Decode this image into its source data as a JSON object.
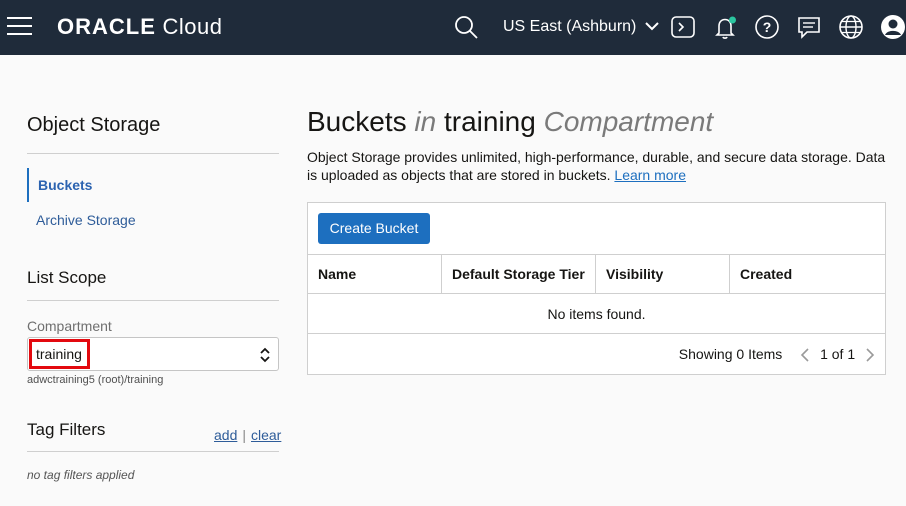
{
  "header": {
    "logo_brand": "ORACLE",
    "logo_product": "Cloud",
    "region": "US East (Ashburn)",
    "icons": [
      "menu-icon",
      "search-icon",
      "chevron-down-icon",
      "cloud-shell-icon",
      "bell-icon",
      "help-icon",
      "chat-icon",
      "globe-icon",
      "user-icon"
    ],
    "colors": {
      "bar": "#1f2b3a",
      "notification_dot": "#2bc6a0"
    }
  },
  "sidebar": {
    "title": "Object Storage",
    "nav": [
      {
        "label": "Buckets",
        "active": true
      },
      {
        "label": "Archive Storage",
        "active": false
      }
    ],
    "list_scope_title": "List Scope",
    "compartment_label": "Compartment",
    "compartment_value": "training",
    "compartment_path": "adwctraining5 (root)/training",
    "tag_filters_title": "Tag Filters",
    "tag_add": "add",
    "tag_sep": "|",
    "tag_clear": "clear",
    "no_tags": "no tag filters applied"
  },
  "main": {
    "title_part1": "Buckets",
    "title_in": "in",
    "title_compartment": "training",
    "title_suffix": "Compartment",
    "description": "Object Storage provides unlimited, high-performance, durable, and secure data storage. Data is uploaded as objects that are stored in buckets.",
    "learn_more": "Learn more",
    "create_button": "Create Bucket",
    "columns": [
      "Name",
      "Default Storage Tier",
      "Visibility",
      "Created"
    ],
    "empty_text": "No items found.",
    "showing": "Showing 0 Items",
    "page_info": "1 of 1",
    "accent_color": "#1d6fbf"
  }
}
